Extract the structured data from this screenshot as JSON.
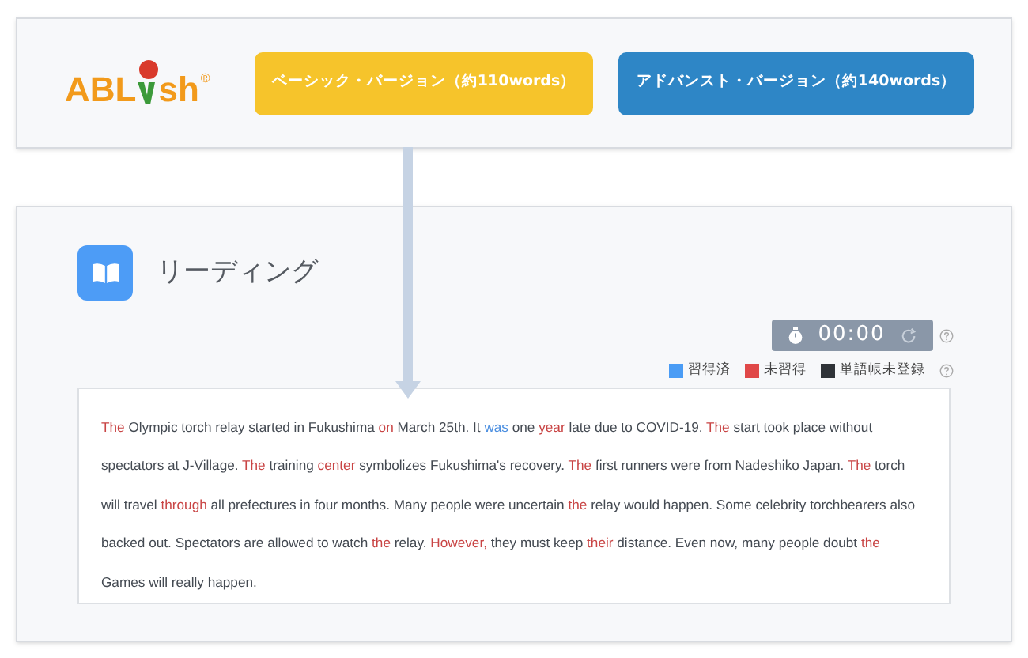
{
  "header": {
    "logo": {
      "before": "ABL",
      "after": "sh",
      "mark": "®"
    },
    "buttons": [
      {
        "label": "ベーシック・バージョン（約110words）",
        "kind": "basic"
      },
      {
        "label": "アドバンスト・バージョン（約140words）",
        "kind": "advanced"
      }
    ]
  },
  "section": {
    "title": "リーディング",
    "timer": {
      "time": "00:00"
    },
    "legend": [
      {
        "label": "習得済",
        "color": "#4a9cf5"
      },
      {
        "label": "未習得",
        "color": "#e04848"
      },
      {
        "label": "単語帳未登録",
        "color": "#2f3338"
      }
    ],
    "passage": [
      {
        "text": "The",
        "kind": "unlearned"
      },
      {
        "text": " Olympic torch relay started in Fukushima ",
        "kind": "plain"
      },
      {
        "text": "on",
        "kind": "unlearned"
      },
      {
        "text": " March 25th. It ",
        "kind": "plain"
      },
      {
        "text": "was",
        "kind": "learned"
      },
      {
        "text": " one ",
        "kind": "plain"
      },
      {
        "text": "year",
        "kind": "unlearned"
      },
      {
        "text": " late due to COVID-19. ",
        "kind": "plain"
      },
      {
        "text": "The",
        "kind": "unlearned"
      },
      {
        "text": " start took place without spectators at J-Village. ",
        "kind": "plain"
      },
      {
        "text": "The",
        "kind": "unlearned"
      },
      {
        "text": " training ",
        "kind": "plain"
      },
      {
        "text": "center",
        "kind": "unlearned"
      },
      {
        "text": " symbolizes Fukushima's recovery. ",
        "kind": "plain"
      },
      {
        "text": "The",
        "kind": "unlearned"
      },
      {
        "text": " first runners were from Nadeshiko Japan. ",
        "kind": "plain"
      },
      {
        "text": "The",
        "kind": "unlearned"
      },
      {
        "text": " torch will travel ",
        "kind": "plain"
      },
      {
        "text": "through",
        "kind": "unlearned"
      },
      {
        "text": " all prefectures in four months. Many people were uncertain ",
        "kind": "plain"
      },
      {
        "text": "the",
        "kind": "unlearned"
      },
      {
        "text": " relay would happen. Some celebrity torchbearers also backed out. Spectators are allowed to watch ",
        "kind": "plain"
      },
      {
        "text": "the",
        "kind": "unlearned"
      },
      {
        "text": " relay. ",
        "kind": "plain"
      },
      {
        "text": "However,",
        "kind": "unlearned"
      },
      {
        "text": " they must keep ",
        "kind": "plain"
      },
      {
        "text": "their",
        "kind": "unlearned"
      },
      {
        "text": " distance. Even now, many people doubt ",
        "kind": "plain"
      },
      {
        "text": "the",
        "kind": "unlearned"
      },
      {
        "text": " Games will really happen.",
        "kind": "plain"
      }
    ]
  }
}
